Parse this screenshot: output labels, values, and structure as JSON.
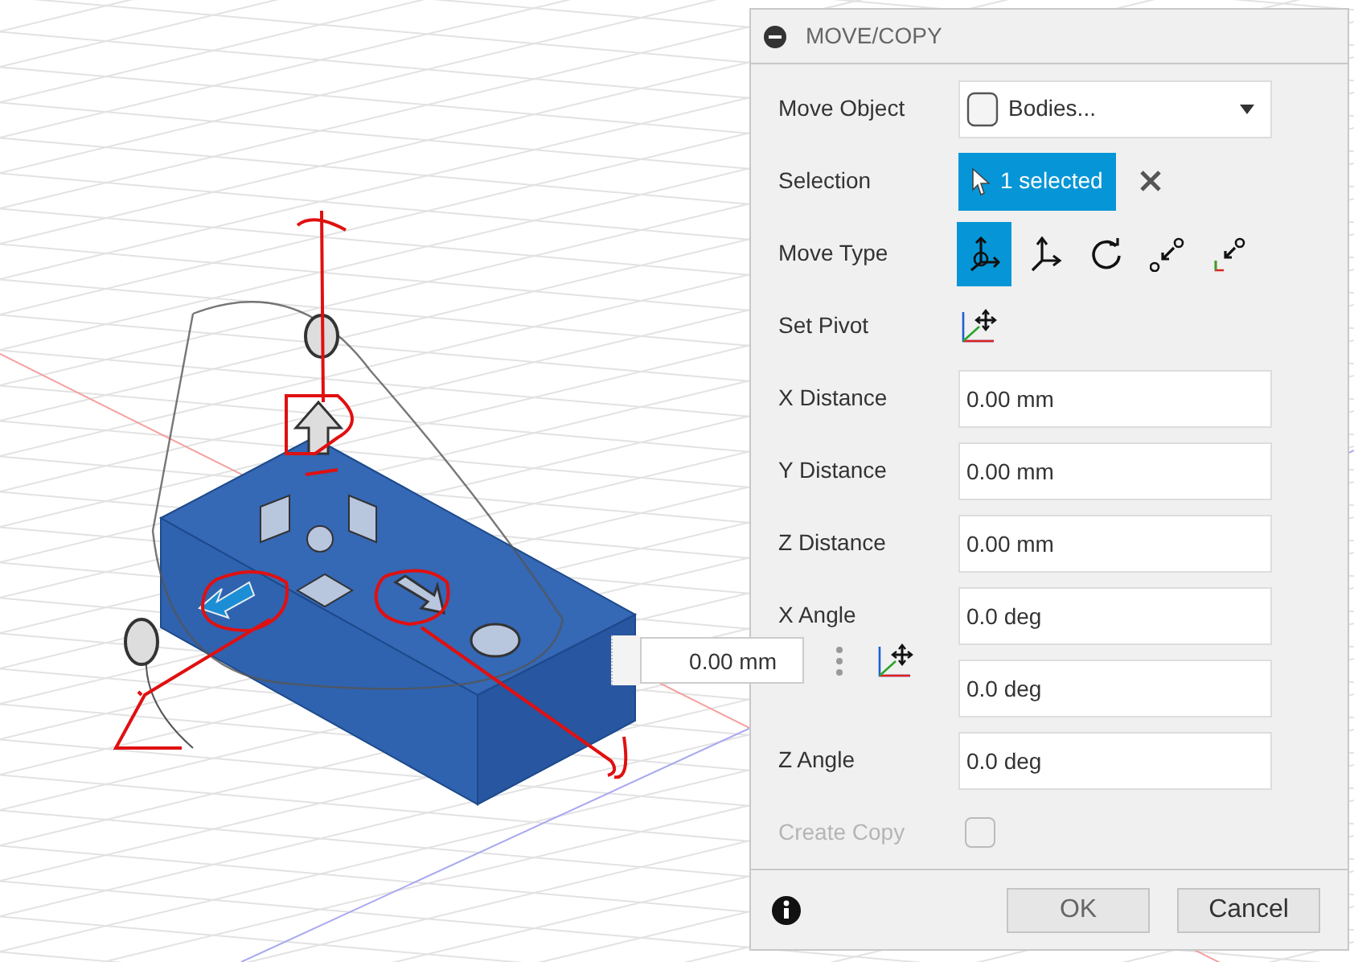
{
  "dialog": {
    "title": "MOVE/COPY",
    "rows": [
      {
        "kind": "dropdown",
        "label": "Move Object",
        "value": "Bodies..."
      },
      {
        "kind": "selection",
        "label": "Selection",
        "value": "1 selected"
      },
      {
        "kind": "icons",
        "label": "Move Type",
        "options": [
          {
            "selected": true
          },
          {
            "selected": false
          },
          {
            "selected": false
          },
          {
            "selected": false
          },
          {
            "selected": false
          }
        ]
      },
      {
        "kind": "pivot",
        "label": "Set Pivot"
      },
      {
        "kind": "input",
        "label": "X Distance",
        "value": "0.00 mm"
      },
      {
        "kind": "input",
        "label": "Y Distance",
        "value": "0.00 mm"
      },
      {
        "kind": "input",
        "label": "Z Distance",
        "value": "0.00 mm"
      },
      {
        "kind": "input",
        "label": "X Angle",
        "value": "0.0 deg"
      },
      {
        "kind": "input",
        "value": "0.0 deg"
      },
      {
        "kind": "input",
        "label": "Z Angle",
        "value": "0.0 deg"
      },
      {
        "kind": "checkbox",
        "label": "Create Copy",
        "checked": false,
        "disabled": true
      }
    ],
    "buttons": [
      "OK",
      "Cancel"
    ]
  },
  "floating_input": {
    "value": "0.00 mm"
  }
}
